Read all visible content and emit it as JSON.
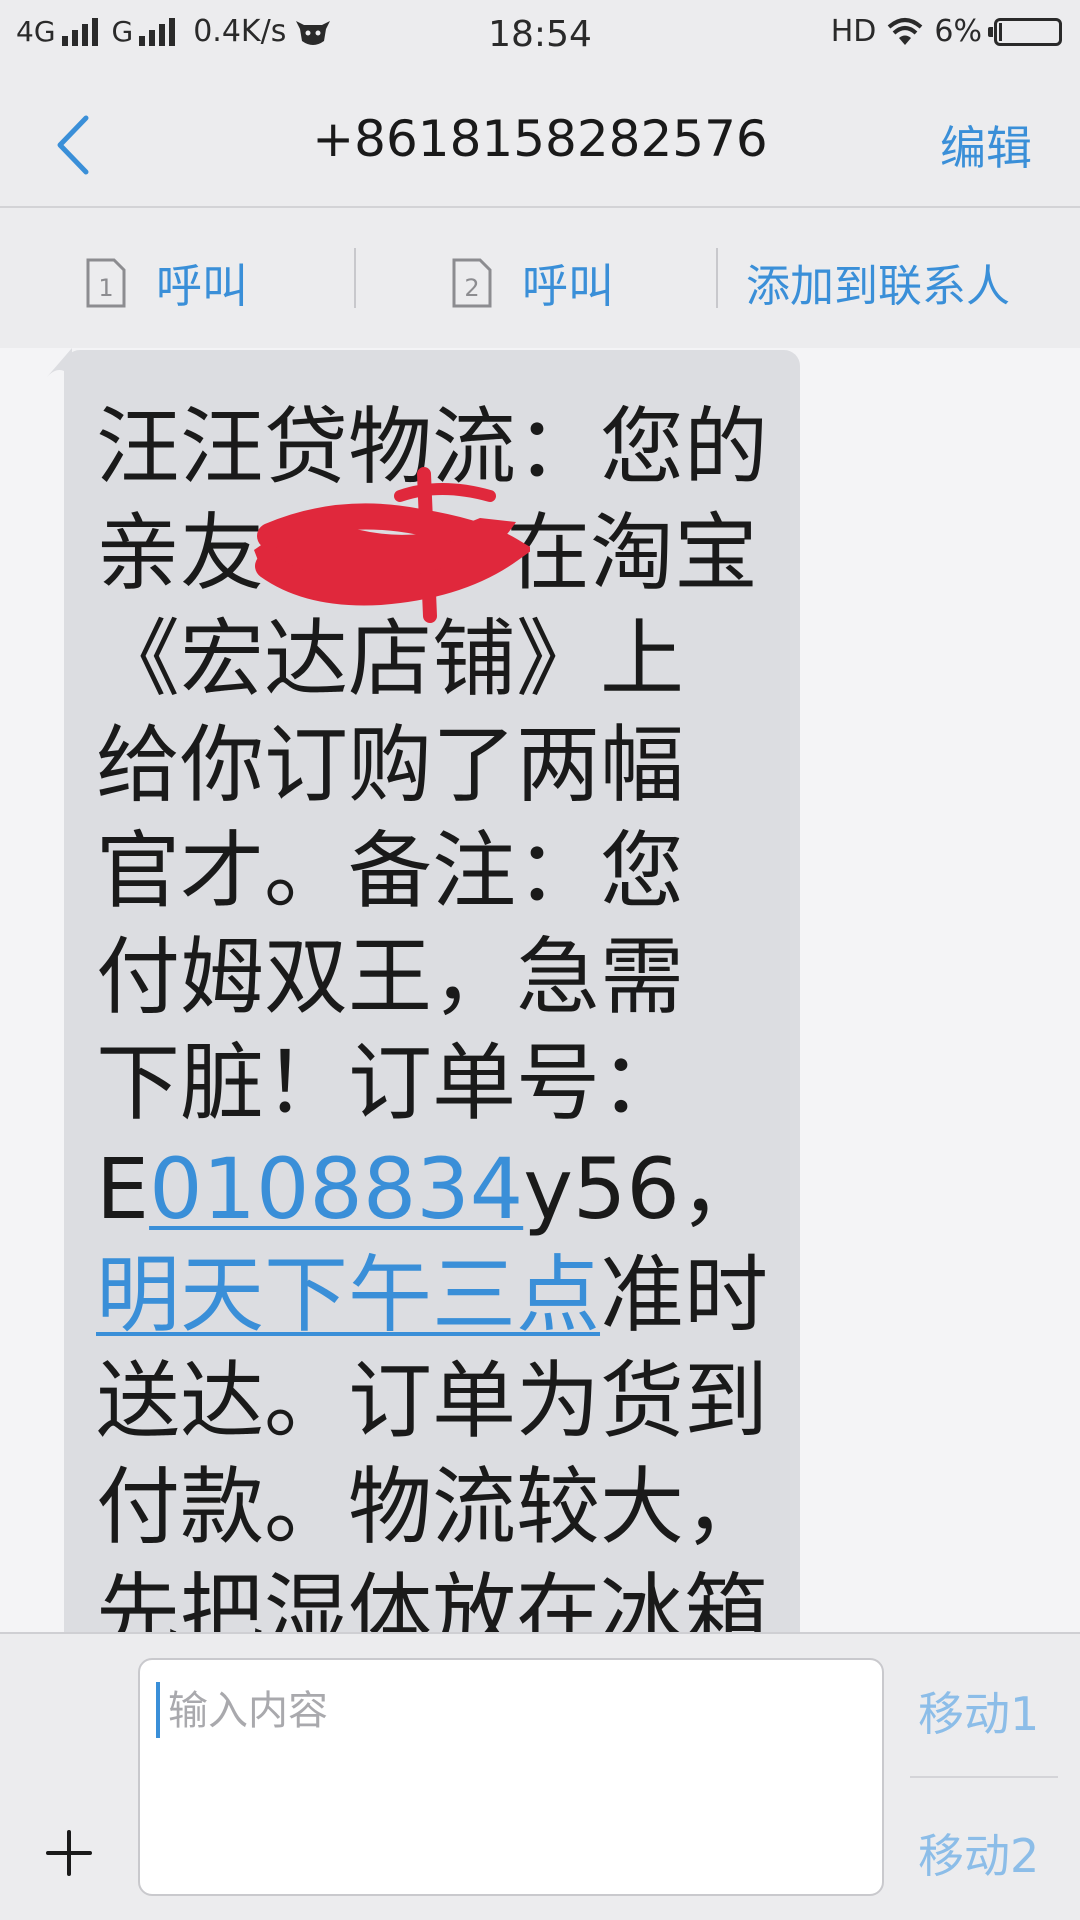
{
  "status_bar": {
    "network": "4G",
    "network2": "G",
    "speed": "0.4K/s",
    "time": "18:54",
    "hd": "HD",
    "battery_percent": "6%",
    "battery_level": 0.06,
    "icons": [
      "signal-icon",
      "cow-icon",
      "wifi-icon",
      "battery-icon"
    ]
  },
  "header": {
    "back_icon": "chevron-left-icon",
    "title": "+8618158282576",
    "edit_label": "编辑"
  },
  "actions": {
    "call1": {
      "sim": "1",
      "label": "呼叫"
    },
    "call2": {
      "sim": "2",
      "label": "呼叫"
    },
    "add_contact": "添加到联系人"
  },
  "message": {
    "lines": [
      "汪汪贷物流：您的",
      "亲友",
      "在淘宝",
      "《宏达店铺》上",
      "给你订购了两幅",
      "官才。备注：您",
      "付姆双王，急需",
      "下脏！订单号：",
      "E",
      "0108834",
      "y56，",
      "明天下午三点",
      "准时",
      "送达。订单为货到",
      "付款。物流较大，",
      "先把湿体放在冰箱"
    ]
  },
  "composer": {
    "plus_icon": "plus-icon",
    "placeholder": "输入内容",
    "send1": "移动1",
    "send2": "移动2"
  },
  "colors": {
    "accent": "#3a8fd8",
    "bubble": "#dcdde1",
    "background": "#f4f4f6",
    "bar": "#ececee",
    "redaction": "#e0283c"
  }
}
